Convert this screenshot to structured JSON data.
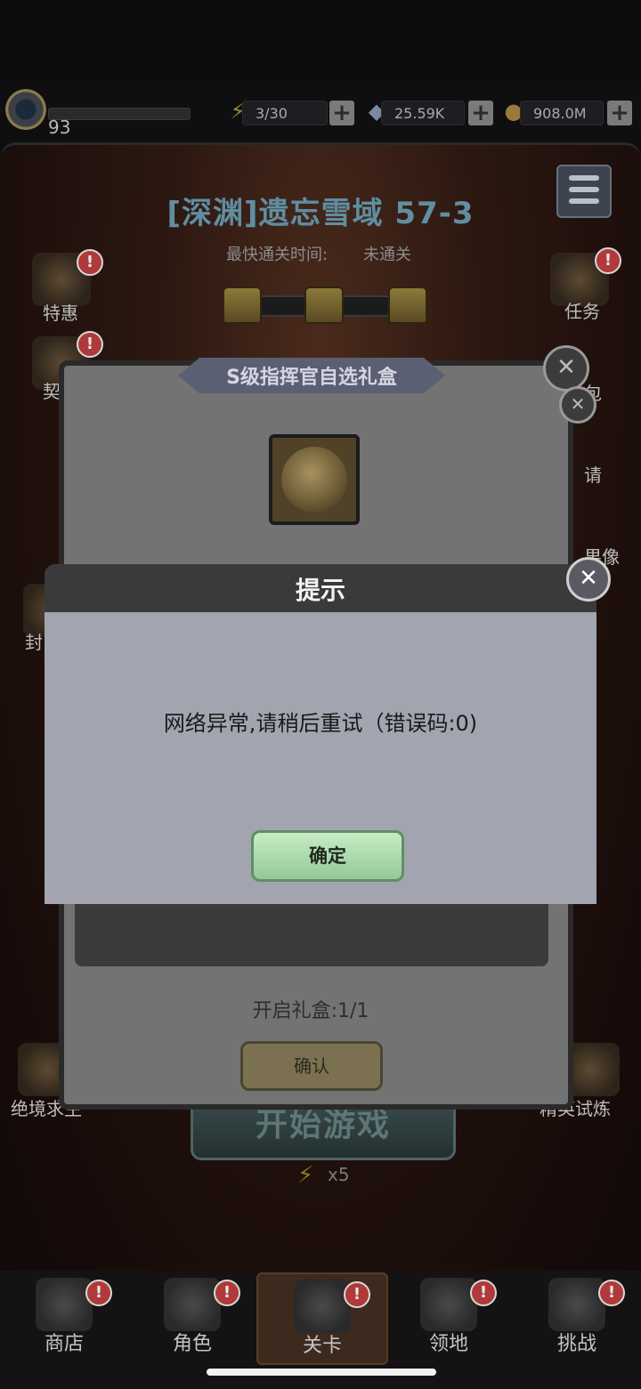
{
  "topbar": {
    "level": "93",
    "energy": "3/30",
    "gems": "25.59K",
    "gold": "908.0M",
    "plus": "+"
  },
  "stage": {
    "title": "[深渊]遗忘雪域 57-3",
    "fastest_label": "最快通关时间:",
    "fastest_value": "未通关"
  },
  "left_sidebar": [
    {
      "label": "特惠"
    },
    {
      "label": "契"
    },
    {
      "label": "封"
    },
    {
      "label": "绝境求生"
    }
  ],
  "right_sidebar": [
    {
      "label": "任务"
    },
    {
      "label": "包"
    },
    {
      "label": "请"
    },
    {
      "label": "果像"
    },
    {
      "label": "精英试炼"
    }
  ],
  "badge_mark": "!",
  "close_mark": "✕",
  "gift_box": {
    "title": "S级指挥官自选礼盒",
    "open_count": "开启礼盒:1/1",
    "confirm": "确认"
  },
  "start": {
    "label": "开始游戏",
    "cost": "x5"
  },
  "alert": {
    "title": "提示",
    "message": "网络异常,请稍后重试（错误码:0)",
    "ok": "确定"
  },
  "nav": [
    {
      "label": "商店"
    },
    {
      "label": "角色"
    },
    {
      "label": "关卡"
    },
    {
      "label": "领地"
    },
    {
      "label": "挑战"
    }
  ]
}
